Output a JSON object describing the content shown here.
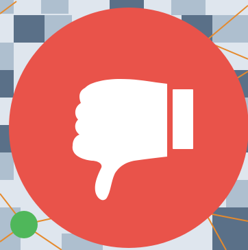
{
  "icon": {
    "name": "thumbs-down-icon",
    "glyph_color": "#ffffff"
  },
  "colors": {
    "circle": "#e9534a",
    "node": "#4fb75a",
    "network_lines": "#e58a2d",
    "checker_dark": "#5a7088",
    "checker_mid": "#aebfcf",
    "checker_light": "#dfe6ee"
  }
}
